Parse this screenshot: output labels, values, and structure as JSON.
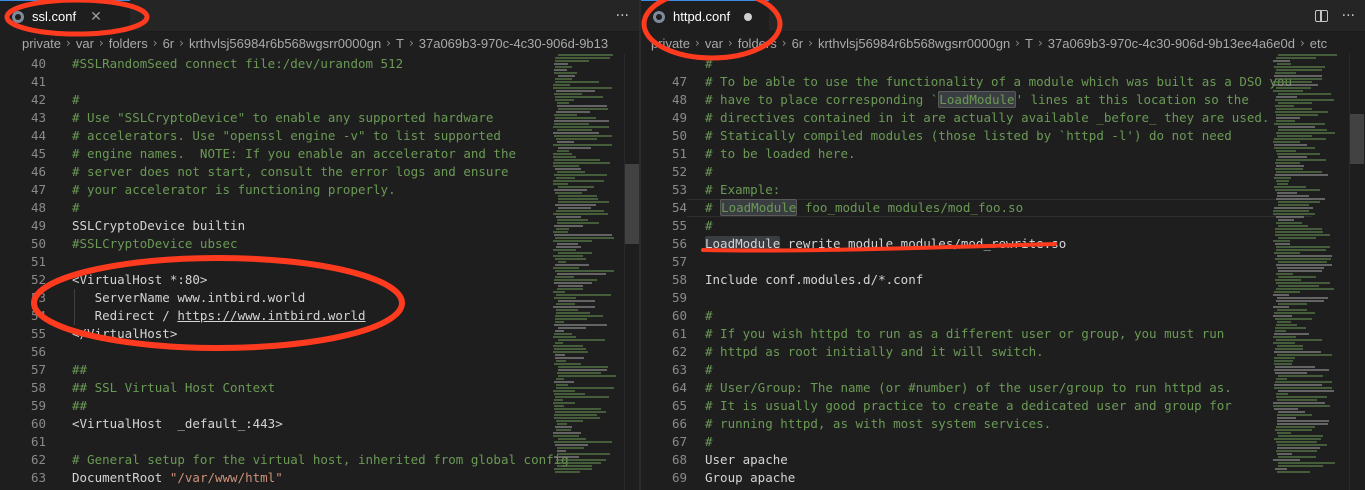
{
  "colors": {
    "editor_bg": "#1e1e1e",
    "comment": "#6a9955",
    "string": "#ce9178",
    "annotation_red": "#ff3b1f",
    "text": "#d4d4d4"
  },
  "left_pane": {
    "tab": {
      "label": "ssl.conf",
      "icon": "config-file-icon",
      "close_icon": "close-icon"
    },
    "actions": {
      "more": "···"
    },
    "breadcrumb": [
      "private",
      "var",
      "folders",
      "6r",
      "krthvlsj56984r6b568wgsrr0000gn",
      "T",
      "37a069b3-970c-4c30-906d-9b13"
    ],
    "lines": [
      {
        "num": "40",
        "text": "#SSLRandomSeed connect file:/dev/urandom 512",
        "kind": "comment"
      },
      {
        "num": "41",
        "text": "",
        "kind": "plain"
      },
      {
        "num": "42",
        "text": "#",
        "kind": "comment"
      },
      {
        "num": "43",
        "text": "# Use \"SSLCryptoDevice\" to enable any supported hardware",
        "kind": "comment"
      },
      {
        "num": "44",
        "text": "# accelerators. Use \"openssl engine -v\" to list supported",
        "kind": "comment"
      },
      {
        "num": "45",
        "text": "# engine names.  NOTE: If you enable an accelerator and the",
        "kind": "comment"
      },
      {
        "num": "46",
        "text": "# server does not start, consult the error logs and ensure",
        "kind": "comment"
      },
      {
        "num": "47",
        "text": "# your accelerator is functioning properly.",
        "kind": "comment"
      },
      {
        "num": "48",
        "text": "#",
        "kind": "comment"
      },
      {
        "num": "49",
        "text": "SSLCryptoDevice builtin",
        "kind": "plain"
      },
      {
        "num": "50",
        "text": "#SSLCryptoDevice ubsec",
        "kind": "comment"
      },
      {
        "num": "51",
        "text": "",
        "kind": "plain"
      },
      {
        "num": "52",
        "text": "<VirtualHost *:80>",
        "kind": "plain"
      },
      {
        "num": "53",
        "text": "   ServerName www.intbird.world",
        "kind": "plain"
      },
      {
        "num": "54",
        "text": "   Redirect / https://www.intbird.world",
        "kind": "redirect",
        "prefix": "   Redirect / ",
        "link": "https://www.intbird.world"
      },
      {
        "num": "55",
        "text": "</VirtualHost>",
        "kind": "plain"
      },
      {
        "num": "56",
        "text": "",
        "kind": "plain"
      },
      {
        "num": "57",
        "text": "##",
        "kind": "comment"
      },
      {
        "num": "58",
        "text": "## SSL Virtual Host Context",
        "kind": "comment"
      },
      {
        "num": "59",
        "text": "##",
        "kind": "comment"
      },
      {
        "num": "60",
        "text": "<VirtualHost  _default_:443>",
        "kind": "plain"
      },
      {
        "num": "61",
        "text": "",
        "kind": "plain"
      },
      {
        "num": "62",
        "text": "# General setup for the virtual host, inherited from global config",
        "kind": "comment"
      },
      {
        "num": "63",
        "text": "DocumentRoot \"/var/www/html\"",
        "kind": "docroot",
        "prefix": "DocumentRoot ",
        "string": "\"/var/www/html\""
      }
    ]
  },
  "right_pane": {
    "tab": {
      "label": "httpd.conf",
      "icon": "config-file-icon",
      "dirty_icon": "unsaved-dot-icon"
    },
    "actions": {
      "split": "split-editor-icon",
      "more": "···"
    },
    "breadcrumb": [
      "private",
      "var",
      "folders",
      "6r",
      "krthvlsj56984r6b568wgsrr0000gn",
      "T",
      "37a069b3-970c-4c30-906d-9b13ee4a6e0d",
      "etc"
    ],
    "lines": [
      {
        "num": "",
        "text": "#",
        "kind": "comment"
      },
      {
        "num": "47",
        "text": "# To be able to use the functionality of a module which was built as a DSO you",
        "kind": "comment"
      },
      {
        "num": "48",
        "text": "# have to place corresponding `LoadModule' lines at this location so the",
        "kind": "comment-hl",
        "before": "# have to place corresponding `",
        "hl": "LoadModule",
        "after": "' lines at this location so the"
      },
      {
        "num": "49",
        "text": "# directives contained in it are actually available _before_ they are used.",
        "kind": "comment"
      },
      {
        "num": "50",
        "text": "# Statically compiled modules (those listed by `httpd -l') do not need",
        "kind": "comment"
      },
      {
        "num": "51",
        "text": "# to be loaded here.",
        "kind": "comment"
      },
      {
        "num": "52",
        "text": "#",
        "kind": "comment"
      },
      {
        "num": "53",
        "text": "# Example:",
        "kind": "comment"
      },
      {
        "num": "54",
        "text": "# LoadModule foo_module modules/mod_foo.so",
        "kind": "comment-hl",
        "before": "# ",
        "hl": "LoadModule",
        "after": " foo_module modules/mod_foo.so"
      },
      {
        "num": "55",
        "text": "#",
        "kind": "comment"
      },
      {
        "num": "56",
        "text": "LoadModule rewrite_module modules/mod_rewrite.so",
        "kind": "plain-hl",
        "before": "",
        "hl": "LoadModule",
        "after": " rewrite_module modules/mod_rewrite.so"
      },
      {
        "num": "57",
        "text": "",
        "kind": "plain"
      },
      {
        "num": "58",
        "text": "Include conf.modules.d/*.conf",
        "kind": "plain"
      },
      {
        "num": "59",
        "text": "",
        "kind": "plain"
      },
      {
        "num": "60",
        "text": "#",
        "kind": "comment"
      },
      {
        "num": "61",
        "text": "# If you wish httpd to run as a different user or group, you must run",
        "kind": "comment"
      },
      {
        "num": "62",
        "text": "# httpd as root initially and it will switch.",
        "kind": "comment"
      },
      {
        "num": "63",
        "text": "#",
        "kind": "comment"
      },
      {
        "num": "64",
        "text": "# User/Group: The name (or #number) of the user/group to run httpd as.",
        "kind": "comment"
      },
      {
        "num": "65",
        "text": "# It is usually good practice to create a dedicated user and group for",
        "kind": "comment"
      },
      {
        "num": "66",
        "text": "# running httpd, as with most system services.",
        "kind": "comment"
      },
      {
        "num": "67",
        "text": "#",
        "kind": "comment"
      },
      {
        "num": "68",
        "text": "User apache",
        "kind": "plain"
      },
      {
        "num": "69",
        "text": "Group apache",
        "kind": "plain"
      },
      {
        "num": "70",
        "text": "",
        "kind": "plain"
      }
    ]
  }
}
